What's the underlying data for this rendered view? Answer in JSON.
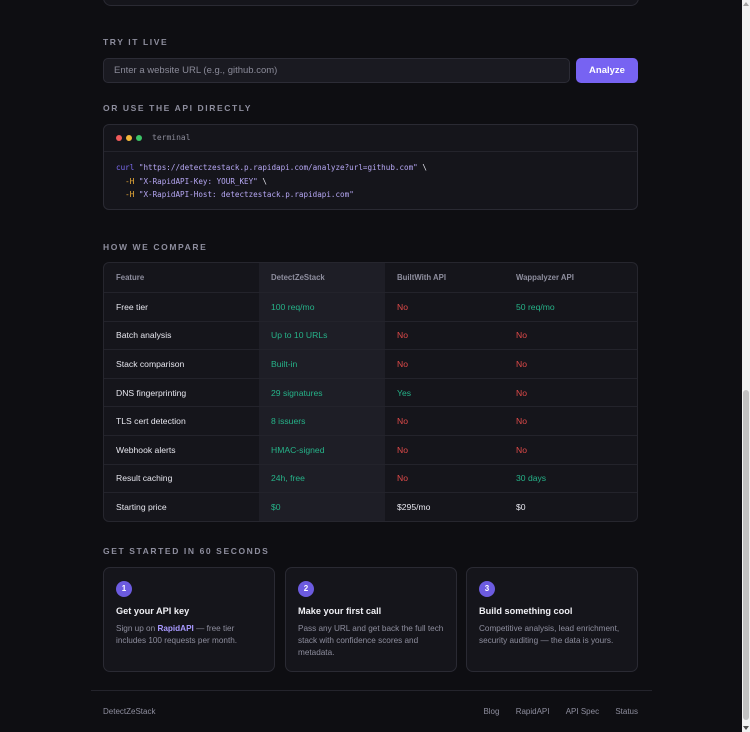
{
  "try_live": {
    "label": "TRY IT LIVE",
    "input_placeholder": "Enter a website URL (e.g., github.com)",
    "button_label": "Analyze"
  },
  "api_direct": {
    "label": "OR USE THE API DIRECTLY",
    "terminal_title": "terminal",
    "code": {
      "line1_cmd": "curl",
      "line1_str": "\"https://detectzestack.p.rapidapi.com/analyze?url=github.com\"",
      "line1_tail": " \\",
      "line2_flag": "-H",
      "line2_str": "\"X-RapidAPI-Key: YOUR_KEY\"",
      "line2_tail": " \\",
      "line3_flag": "-H",
      "line3_str": "\"X-RapidAPI-Host: detectzestack.p.rapidapi.com\""
    }
  },
  "compare": {
    "label": "HOW WE COMPARE",
    "headers": [
      "Feature",
      "DetectZeStack",
      "BuiltWith API",
      "Wappalyzer API"
    ],
    "rows": [
      {
        "feature": "Free tier",
        "cells": [
          {
            "v": "100 req/mo",
            "s": "good"
          },
          {
            "v": "No",
            "s": "bad"
          },
          {
            "v": "50 req/mo",
            "s": "good"
          }
        ]
      },
      {
        "feature": "Batch analysis",
        "cells": [
          {
            "v": "Up to 10 URLs",
            "s": "good"
          },
          {
            "v": "No",
            "s": "bad"
          },
          {
            "v": "No",
            "s": "bad"
          }
        ]
      },
      {
        "feature": "Stack comparison",
        "cells": [
          {
            "v": "Built-in",
            "s": "good"
          },
          {
            "v": "No",
            "s": "bad"
          },
          {
            "v": "No",
            "s": "bad"
          }
        ]
      },
      {
        "feature": "DNS fingerprinting",
        "cells": [
          {
            "v": "29 signatures",
            "s": "good"
          },
          {
            "v": "Yes",
            "s": "good"
          },
          {
            "v": "No",
            "s": "bad"
          }
        ]
      },
      {
        "feature": "TLS cert detection",
        "cells": [
          {
            "v": "8 issuers",
            "s": "good"
          },
          {
            "v": "No",
            "s": "bad"
          },
          {
            "v": "No",
            "s": "bad"
          }
        ]
      },
      {
        "feature": "Webhook alerts",
        "cells": [
          {
            "v": "HMAC-signed",
            "s": "good"
          },
          {
            "v": "No",
            "s": "bad"
          },
          {
            "v": "No",
            "s": "bad"
          }
        ]
      },
      {
        "feature": "Result caching",
        "cells": [
          {
            "v": "24h, free",
            "s": "good"
          },
          {
            "v": "No",
            "s": "bad"
          },
          {
            "v": "30 days",
            "s": "good"
          }
        ]
      },
      {
        "feature": "Starting price",
        "cells": [
          {
            "v": "$0",
            "s": "good"
          },
          {
            "v": "$295/mo",
            "s": "plain"
          },
          {
            "v": "$0",
            "s": "plain"
          }
        ]
      }
    ]
  },
  "get_started": {
    "label": "GET STARTED IN 60 SECONDS",
    "steps": [
      {
        "num": "1",
        "title": "Get your API key",
        "desc_pre": "Sign up on ",
        "desc_link": "RapidAPI",
        "desc_post": " — free tier includes 100 requests per month."
      },
      {
        "num": "2",
        "title": "Make your first call",
        "desc_pre": "Pass any URL and get back the full tech stack with confidence scores and metadata.",
        "desc_link": "",
        "desc_post": ""
      },
      {
        "num": "3",
        "title": "Build something cool",
        "desc_pre": "Competitive analysis, lead enrichment, security auditing — the data is yours.",
        "desc_link": "",
        "desc_post": ""
      }
    ]
  },
  "footer": {
    "brand": "DetectZeStack",
    "links": [
      "Blog",
      "RapidAPI",
      "API Spec",
      "Status"
    ]
  },
  "colors": {
    "accent": "#7763f2",
    "good": "#26b389",
    "bad": "#e14a4a",
    "background": "#0e0e12"
  }
}
